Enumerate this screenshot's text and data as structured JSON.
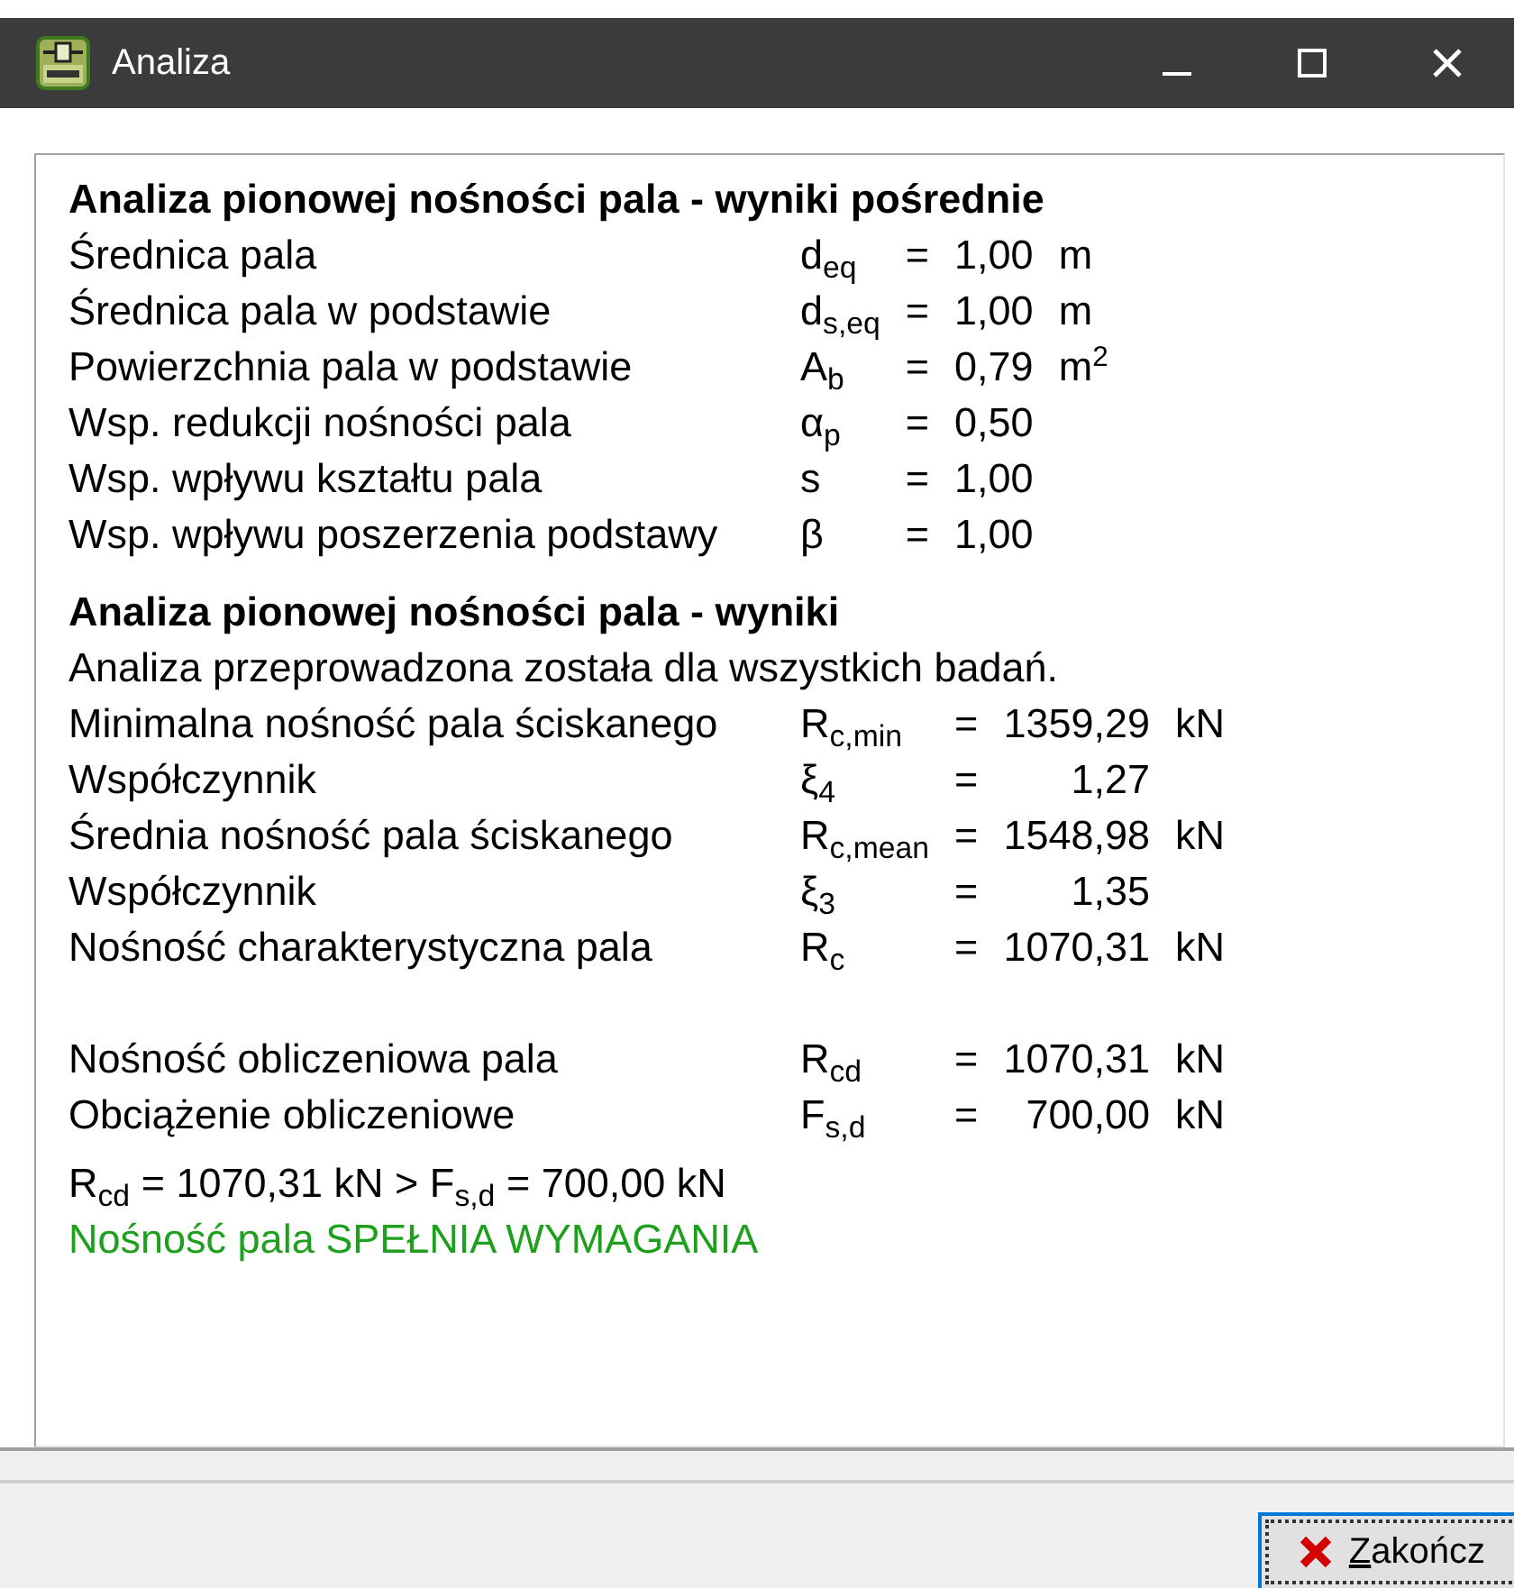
{
  "window": {
    "title": "Analiza"
  },
  "sections": [
    {
      "heading": "Analiza pionowej nośności pala - wyniki pośrednie",
      "rows": [
        {
          "label": "Średnica pala",
          "symbol": "d$_{eq}$",
          "relation": "=",
          "value": "1,00",
          "unit": "m"
        },
        {
          "label": "Średnica pala w podstawie",
          "symbol": "d$_{s,eq}$",
          "relation": "=",
          "value": "1,00",
          "unit": "m"
        },
        {
          "label": "Powierzchnia pala w podstawie",
          "symbol": "A$_{b}$",
          "relation": "=",
          "value": "0,79",
          "unit": "m$^{2}$"
        },
        {
          "label": "Wsp. redukcji nośności pala",
          "symbol": "α$_{p}$",
          "relation": "=",
          "value": "0,50"
        },
        {
          "label": "Wsp. wpływu kształtu pala",
          "symbol": "s",
          "relation": "=",
          "value": "1,00"
        },
        {
          "label": "Wsp. wpływu poszerzenia podstawy",
          "symbol": "β",
          "relation": "=",
          "value": "1,00"
        }
      ]
    },
    {
      "heading": "Analiza pionowej nośności pala - wyniki",
      "note": "Analiza przeprowadzona została dla wszystkich badań.",
      "rows": [
        {
          "label": "Minimalna nośność pala ściskanego",
          "symbol": "R$_{c,min}$",
          "relation": "=",
          "value": "1359,29",
          "unit": "kN"
        },
        {
          "label": "Współczynnik",
          "symbol": "ξ$_{4}$",
          "relation": "=",
          "value": "1,27"
        },
        {
          "label": "Średnia nośność pala ściskanego",
          "symbol": "R$_{c,mean}$",
          "relation": "=",
          "value": "1548,98",
          "unit": "kN"
        },
        {
          "label": "Współczynnik",
          "symbol": "ξ$_{3}$",
          "relation": "=",
          "value": "1,35"
        },
        {
          "label": "Nośność charakterystyczna pala",
          "symbol": "R$_{c}$",
          "relation": "=",
          "value": "1070,31",
          "unit": "kN"
        },
        {
          "label": "Nośność obliczeniowa pala",
          "symbol": "R$_{cd}$",
          "relation": "=",
          "value": "1070,31",
          "unit": "kN",
          "gap_before": true
        },
        {
          "label": "Obciążenie obliczeniowe",
          "symbol": "F$_{s,d}$",
          "relation": "=",
          "value": "700,00",
          "unit": "kN"
        }
      ],
      "check": "R$_{cd}$ = 1070,31 kN > F$_{s,d}$ = 700,00 kN",
      "verdict": {
        "text": "Nośność pala SPEŁNIA WYMAGANIA",
        "satisfied": true
      }
    }
  ],
  "buttons": [
    {
      "label": "Zakończ",
      "kind": "close",
      "focused": true
    }
  ]
}
